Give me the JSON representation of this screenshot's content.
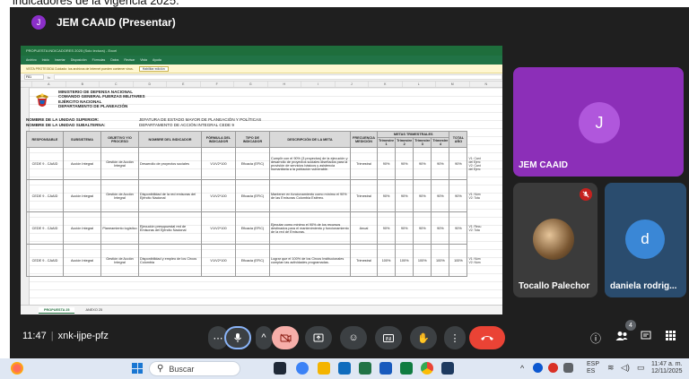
{
  "caption": {
    "text": "indicadores de la vigencia 2025."
  },
  "presenter": {
    "initial": "J",
    "title": "JEM CAAID (Presentar)"
  },
  "excel": {
    "title_bar": "PROPUESTA INDICADORES 2025 (Solo lectura) - Excel",
    "ribbon_tabs": [
      "Archivo",
      "Inicio",
      "Insertar",
      "Disposición",
      "Fórmulas",
      "Datos",
      "Revisar",
      "Vista",
      "Ayuda"
    ],
    "protected_notice": "VISTA PROTEGIDA  Cuidado: los archivos de Internet pueden contener virus.",
    "protected_button": "Habilitar edición",
    "name_box": "F81",
    "header_lines": [
      "MINISTERIO DE DEFENSA NACIONAL",
      "COMANDO GENERAL FUERZAS MILITARES",
      "EJÉRCITO NACIONAL",
      "DEPARTAMENTO DE PLANEACIÓN"
    ],
    "unit_labels": [
      "NOMBRE DE LA UNIDAD SUPERIOR:",
      "NOMBRE DE LA UNIDAD SUBALTERNA:"
    ],
    "unit_values": [
      "JEFATURA DE ESTADO MAYOR DE PLANEACIÓN Y POLÍTICAS",
      "DEPARTAMENTO DE ACCIÓN INTEGRAL  CEDE 9"
    ],
    "columns": [
      "RESPONSABLE",
      "SUBSISTEMA",
      "OBJETIVO Y/O PROCESO",
      "NOMBRE DEL INDICADOR",
      "FÓRMULA DEL INDICADOR",
      "TIPO DE INDICADOR",
      "DESCRIPCIÓN DE LA META",
      "FRECUENCIA MEDICIÓN",
      "METAS TRIMESTRALES",
      "TOTAL AÑO"
    ],
    "quarters": [
      "Trimestre 1",
      "Trimestre 2",
      "Trimestre 3",
      "Trimestre 4"
    ],
    "rows": [
      {
        "resp": "CEDE 9 - CAAID",
        "sub": "Acción Integral",
        "obj": "Gestión de Acción Integral",
        "name": "Desarrollo de proyectos sociales",
        "formula": "V1/V2*100",
        "type": "Eficacia (EFIC)",
        "desc": "Cumplir con el 90% (3 proyectos) de la ejecución y desarrollo de proyectos sociales diseñados para la provisión de servicios básicos y asistencia humanitaria a la población vulnerable.",
        "freq": "Trimestral",
        "q": [
          "90%",
          "90%",
          "90%",
          "90%"
        ],
        "total": "90%",
        "side": [
          "V1: Cant",
          "del Ejerc",
          "V2: Cant",
          "del Ejerc"
        ]
      },
      {
        "resp": "CEDE 9 - CAAID",
        "sub": "Acción Integral",
        "obj": "Gestión de Acción Integral",
        "name": "Disponibilidad de la red emisoras del Ejército Nacional",
        "formula": "V1/V2*100",
        "type": "Eficacia (EFIC)",
        "desc": "Mantener en funcionamiento como mínimo el 90% de las Emisoras Colombia Estéreo.",
        "freq": "Trimestral",
        "q": [
          "90%",
          "90%",
          "90%",
          "90%"
        ],
        "total": "90%",
        "side": [
          "V1: Núm",
          "",
          "V2: Tota"
        ]
      },
      {
        "resp": "CEDE 9 - CAAID",
        "sub": "Acción Integral",
        "obj": "Planeamiento logístico",
        "name": "Ejecución presupuestal red de Emisoras del Ejército Nacional",
        "formula": "V1/V2*100",
        "type": "Eficacia (EFIC)",
        "desc": "Ejecutar como mínimo el 90% de los recursos destinados para el mantenimiento y funcionamiento de la red de Emisoras.",
        "freq": "Anual",
        "q": [
          "90%",
          "90%",
          "90%",
          "90%"
        ],
        "total": "90%",
        "side": [
          "V1: Recu",
          "",
          "V2: Tota"
        ]
      },
      {
        "resp": "CEDE 9 - CAAID",
        "sub": "Acción Integral",
        "obj": "Gestión de Acción Integral",
        "name": "Disponibilidad y empleo de los Circos Colombia",
        "formula": "V1/V2*100",
        "type": "Eficacia (EFIC)",
        "desc": "Lograr que el 100% de los Circos Institucionales cumplan las actividades programadas.",
        "freq": "Trimestral",
        "q": [
          "100%",
          "100%",
          "100%",
          "100%"
        ],
        "total": "100%",
        "side": [
          "V1: Núm",
          "",
          "V2: Núm"
        ]
      }
    ],
    "sheet_tabs": [
      "PROPUESTA 25",
      "ANEXO 25"
    ]
  },
  "participants": [
    {
      "name": "JEM CAAID",
      "initial": "J",
      "color": "#8c2fb8"
    },
    {
      "name": "Tocallo Palechor",
      "muted": true
    },
    {
      "name": "daniela rodrig...",
      "initial": "d",
      "color": "#2a4c6e"
    }
  ],
  "meeting": {
    "time": "11:47",
    "code": "xnk-ijpe-pfz",
    "people_count": "4"
  },
  "taskbar": {
    "search_placeholder": "Buscar",
    "lang_top": "ESP",
    "lang_bottom": "ES",
    "time": "11:47 a. m.",
    "date": "12/11/2025"
  }
}
